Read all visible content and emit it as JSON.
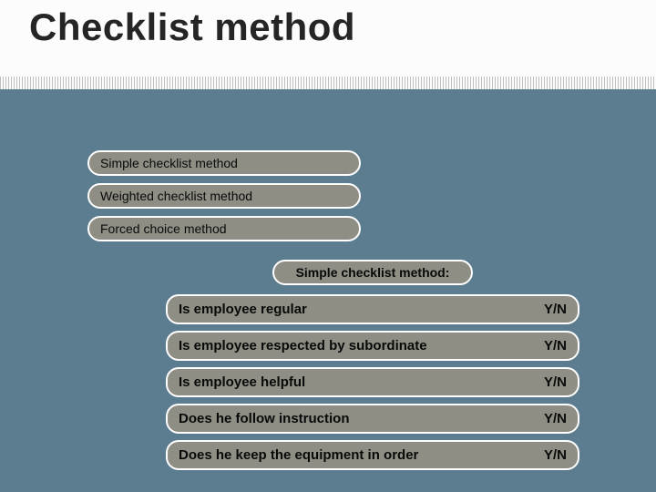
{
  "title": "Checklist method",
  "methods": [
    "Simple checklist method",
    "Weighted checklist method",
    "Forced choice method"
  ],
  "detail_title": "Simple checklist method:",
  "questions": [
    {
      "q": "Is employee regular",
      "a": "Y/N"
    },
    {
      "q": "Is employee respected by subordinate",
      "a": "Y/N"
    },
    {
      "q": "Is employee helpful",
      "a": "Y/N"
    },
    {
      "q": "Does he follow instruction",
      "a": "Y/N"
    },
    {
      "q": "Does he keep the equipment in order",
      "a": "Y/N"
    }
  ]
}
